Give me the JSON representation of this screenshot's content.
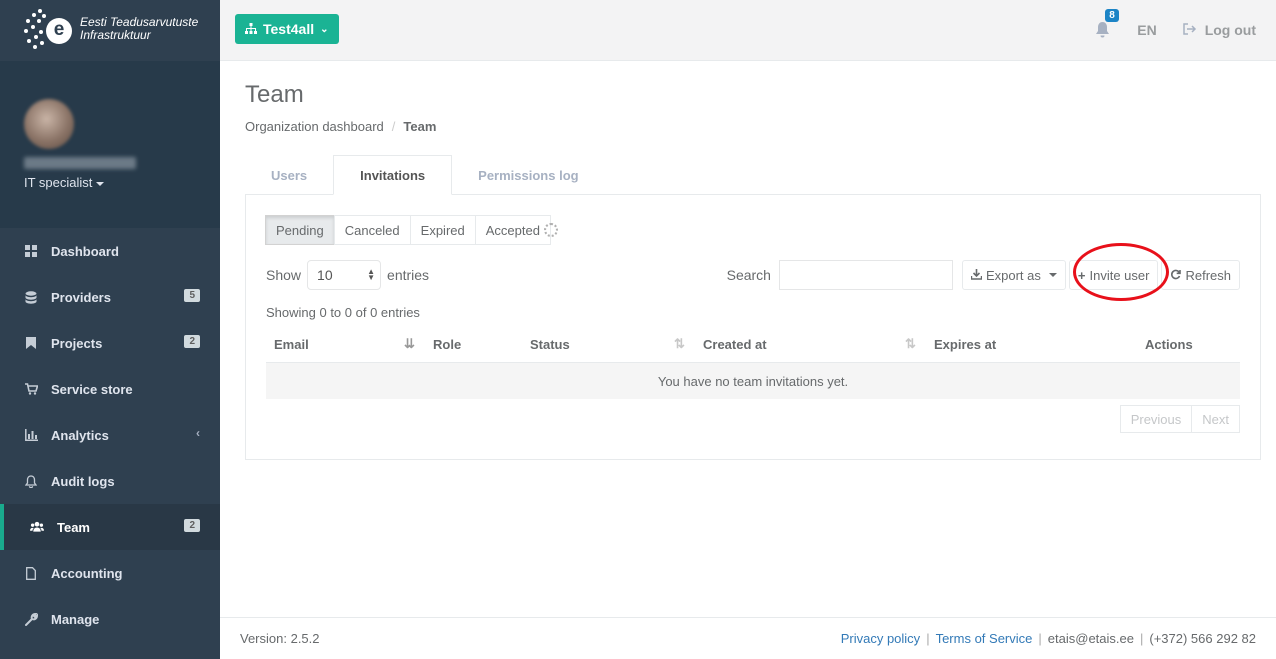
{
  "brand": {
    "line1": "Eesti Teadusarvutuste",
    "line2": "Infrastruktuur",
    "logo_letter": "e"
  },
  "profile": {
    "role": "IT specialist"
  },
  "sidebar": {
    "items": [
      {
        "label": "Dashboard",
        "icon": "th-large-icon",
        "badge": ""
      },
      {
        "label": "Providers",
        "icon": "database-icon",
        "badge": "5"
      },
      {
        "label": "Projects",
        "icon": "bookmark-icon",
        "badge": "2"
      },
      {
        "label": "Service store",
        "icon": "shopping-cart-icon",
        "badge": ""
      },
      {
        "label": "Analytics",
        "icon": "bar-chart-icon",
        "badge": ""
      },
      {
        "label": "Audit logs",
        "icon": "bell-outline-icon",
        "badge": ""
      },
      {
        "label": "Team",
        "icon": "users-icon",
        "badge": "2"
      },
      {
        "label": "Accounting",
        "icon": "file-icon",
        "badge": ""
      },
      {
        "label": "Manage",
        "icon": "wrench-icon",
        "badge": ""
      }
    ]
  },
  "topbar": {
    "org_label": "Test4all",
    "notifications_count": "8",
    "language": "EN",
    "logout_label": "Log out"
  },
  "page": {
    "title": "Team",
    "breadcrumb": {
      "parent": "Organization dashboard",
      "current": "Team"
    }
  },
  "tabs": [
    "Users",
    "Invitations",
    "Permissions log"
  ],
  "filters": [
    "Pending",
    "Canceled",
    "Expired",
    "Accepted"
  ],
  "controls": {
    "show_label": "Show",
    "entries_value": "10",
    "entries_label": "entries",
    "search_label": "Search",
    "search_value": "",
    "export_label": "Export as",
    "invite_label": "Invite user",
    "refresh_label": "Refresh"
  },
  "table": {
    "info": "Showing 0 to 0 of 0 entries",
    "columns": [
      "Email",
      "Role",
      "Status",
      "Created at",
      "Expires at",
      "Actions"
    ],
    "empty_message": "You have no team invitations yet.",
    "previous_label": "Previous",
    "next_label": "Next"
  },
  "footer": {
    "version": "Version: 2.5.2",
    "privacy": "Privacy policy",
    "terms": "Terms of Service",
    "email": "etais@etais.ee",
    "phone": "(+372) 566 292 82"
  },
  "colors": {
    "sidebar": "#2f4050",
    "accent": "#1ab394",
    "highlight": "#e8101a",
    "badge_blue": "#1c84c6"
  }
}
